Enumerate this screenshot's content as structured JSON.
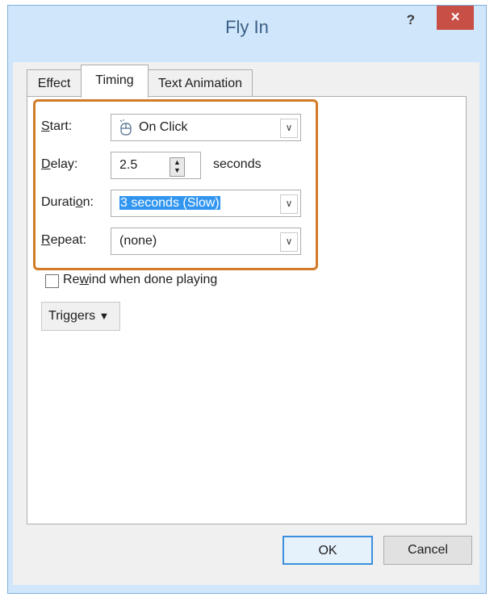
{
  "dialog": {
    "title": "Fly In",
    "help_label": "?",
    "close_label": "×"
  },
  "tabs": [
    {
      "label": "Effect",
      "active": false
    },
    {
      "label": "Timing",
      "active": true
    },
    {
      "label": "Text Animation",
      "active": false
    }
  ],
  "timing": {
    "start": {
      "label_mnemonic": "S",
      "label_rest": "tart:",
      "value": "On Click",
      "icon": "mouse-icon"
    },
    "delay": {
      "label_mnemonic": "D",
      "label_rest": "elay:",
      "value": "2.5",
      "unit": "seconds"
    },
    "duration": {
      "label_pre": "Durati",
      "label_mnemonic": "o",
      "label_post": "n:",
      "value": "3 seconds (Slow)"
    },
    "repeat": {
      "label_mnemonic": "R",
      "label_rest": "epeat:",
      "value": "(none)"
    }
  },
  "rewind": {
    "label_pre": "Re",
    "label_mnemonic": "w",
    "label_post": "ind when done playing",
    "checked": false
  },
  "triggers": {
    "label_mnemonic": "T",
    "label_rest": "riggers",
    "icon": "double-chevron-down-icon"
  },
  "buttons": {
    "ok": "OK",
    "cancel": "Cancel"
  },
  "colors": {
    "highlight_border": "#d27a27",
    "selection": "#3296f0",
    "close_button": "#c84f46"
  }
}
